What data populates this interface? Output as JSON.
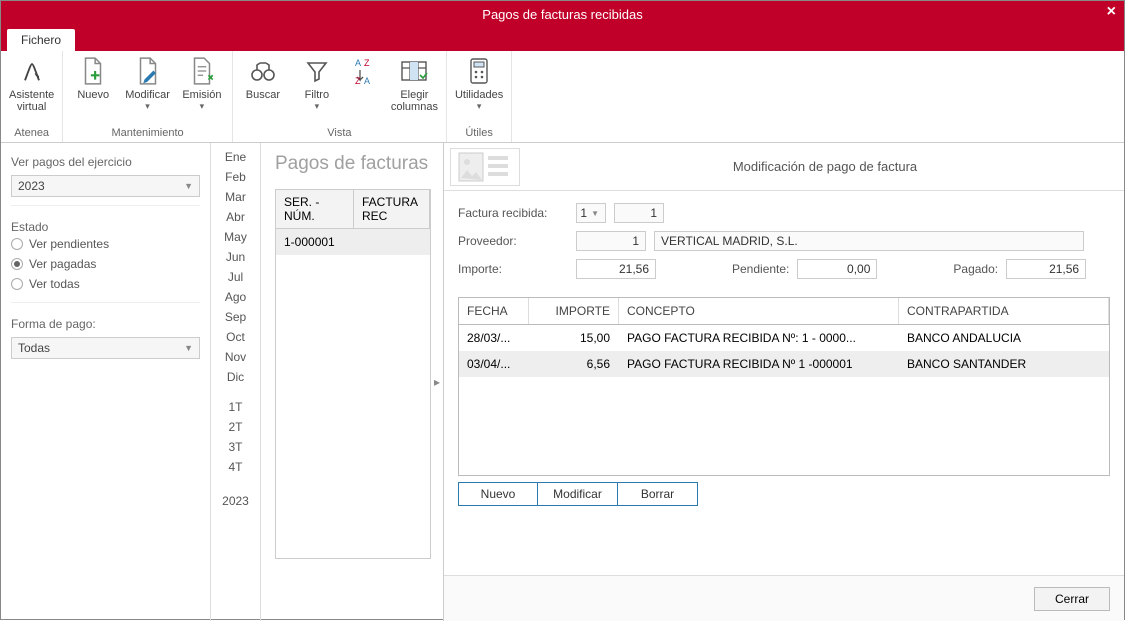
{
  "window": {
    "title": "Pagos de facturas recibidas"
  },
  "tabs": {
    "fichero": "Fichero"
  },
  "ribbon": {
    "asistente": "Asistente\nvirtual",
    "nuevo": "Nuevo",
    "modificar": "Modificar",
    "emision": "Emisión",
    "buscar": "Buscar",
    "filtro": "Filtro",
    "az": "",
    "elegir": "Elegir\ncolumnas",
    "utilidades": "Utilidades",
    "group_atenea": "Atenea",
    "group_mant": "Mantenimiento",
    "group_vista": "Vista",
    "group_utiles": "Útiles"
  },
  "sidebar": {
    "ver_pagos": "Ver pagos del ejercicio",
    "year": "2023",
    "estado": "Estado",
    "r_pend": "Ver pendientes",
    "r_pag": "Ver pagadas",
    "r_todas": "Ver todas",
    "forma": "Forma de pago:",
    "forma_val": "Todas"
  },
  "months": [
    "Ene",
    "Feb",
    "Mar",
    "Abr",
    "May",
    "Jun",
    "Jul",
    "Ago",
    "Sep",
    "Oct",
    "Nov",
    "Dic",
    "",
    "1T",
    "2T",
    "3T",
    "4T",
    "",
    "2023"
  ],
  "list": {
    "title": "Pagos de facturas",
    "col1": "SER. - NÚM.",
    "col2": "FACTURA REC",
    "row1": "1-000001"
  },
  "detail": {
    "title": "Modificación de pago de factura",
    "factura_lbl": "Factura recibida:",
    "factura_ser": "1",
    "factura_num": "1",
    "prov_lbl": "Proveedor:",
    "prov_cod": "1",
    "prov_nom": "VERTICAL MADRID, S.L.",
    "importe_lbl": "Importe:",
    "importe": "21,56",
    "pend_lbl": "Pendiente:",
    "pend": "0,00",
    "pag_lbl": "Pagado:",
    "pag": "21,56",
    "cols": {
      "fecha": "FECHA",
      "importe": "IMPORTE",
      "concepto": "CONCEPTO",
      "contra": "CONTRAPARTIDA"
    },
    "rows": [
      {
        "fecha": "28/03/...",
        "imp": "15,00",
        "conc": "PAGO FACTURA RECIBIDA Nº: 1 - 0000...",
        "contra": "BANCO ANDALUCIA"
      },
      {
        "fecha": "03/04/...",
        "imp": "6,56",
        "conc": "PAGO FACTURA RECIBIDA Nº 1 -000001",
        "contra": "BANCO SANTANDER"
      }
    ],
    "btn_nuevo": "Nuevo",
    "btn_mod": "Modificar",
    "btn_borrar": "Borrar",
    "btn_cerrar": "Cerrar"
  }
}
